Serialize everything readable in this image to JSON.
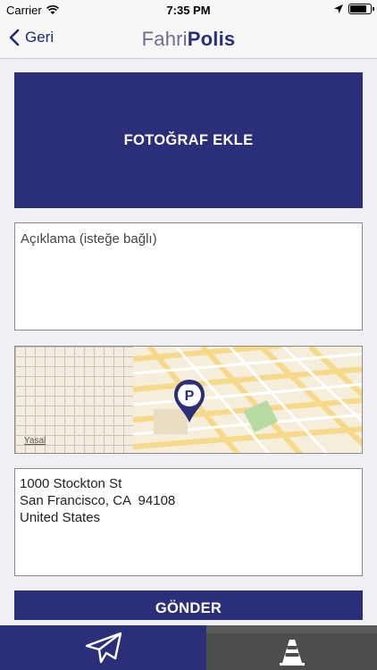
{
  "status_bar": {
    "carrier": "Carrier",
    "time": "7:35 PM"
  },
  "nav": {
    "back_label": "Geri",
    "logo_light": "Fahri",
    "logo_bold": "Polis"
  },
  "form": {
    "photo_button_label": "FOTOĞRAF EKLE",
    "description_placeholder": "Açıklama (isteğe bağlı)",
    "map_legal_label": "Yasal",
    "address_lines": [
      "1000 Stockton St",
      "San Francisco, CA  94108",
      "United States"
    ],
    "send_button_label": "GÖNDER"
  },
  "tabs": [
    {
      "icon": "paper-plane-icon",
      "active": true
    },
    {
      "icon": "traffic-cone-icon",
      "active": false
    }
  ],
  "colors": {
    "brand_navy": "#2b2f7a",
    "tab_inactive": "#4d4d4d"
  }
}
